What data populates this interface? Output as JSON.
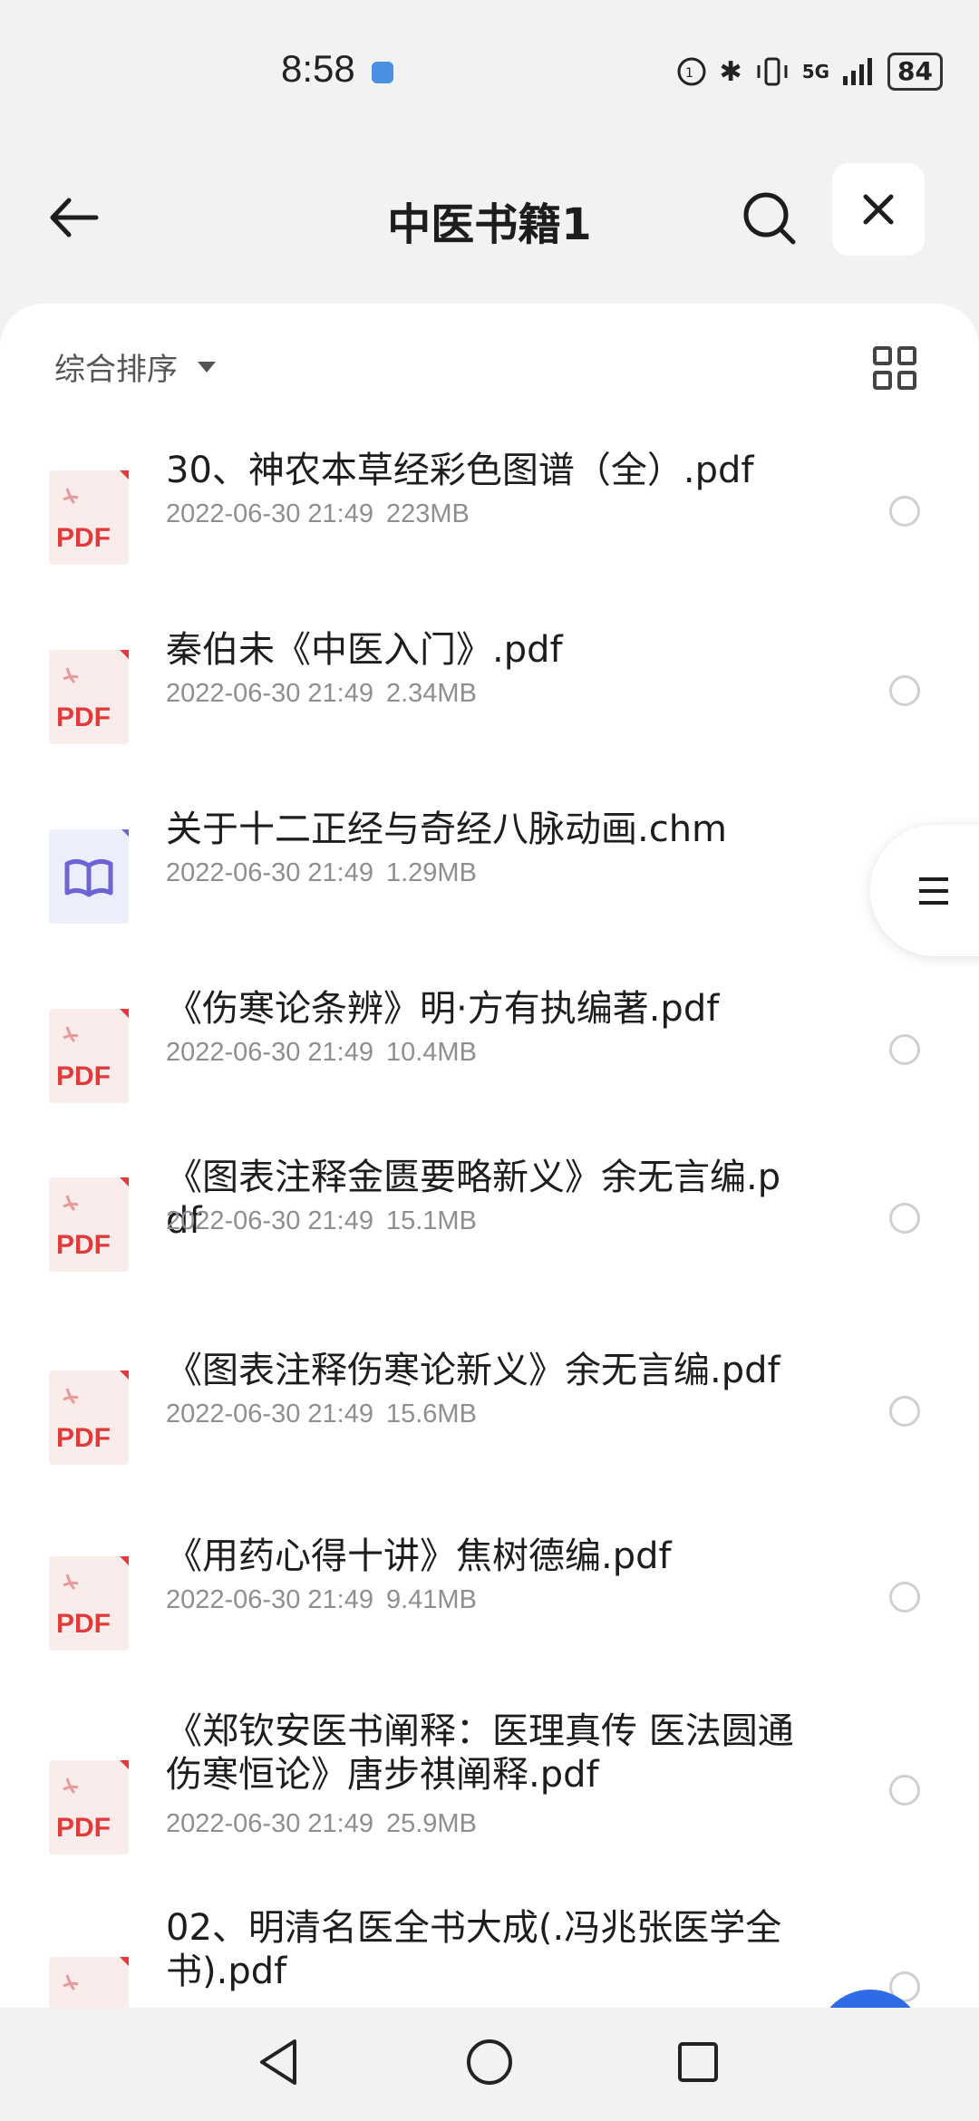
{
  "status": {
    "time": "8:58",
    "battery": "84",
    "network": "5G"
  },
  "header": {
    "title": "中医书籍1"
  },
  "sort": {
    "label": "综合排序"
  },
  "files": [
    {
      "name": "30、神农本草经彩色图谱（全）.pdf",
      "date": "2022-06-30 21:49",
      "size": "223MB",
      "type": "pdf"
    },
    {
      "name": "秦伯未《中医入门》.pdf",
      "date": "2022-06-30 21:49",
      "size": "2.34MB",
      "type": "pdf"
    },
    {
      "name": "关于十二正经与奇经八脉动画.chm",
      "date": "2022-06-30 21:49",
      "size": "1.29MB",
      "type": "chm"
    },
    {
      "name": "《伤寒论条辨》明·方有执编著.pdf",
      "date": "2022-06-30 21:49",
      "size": "10.4MB",
      "type": "pdf"
    },
    {
      "name": "《图表注释金匮要略新义》余无言编.pdf",
      "date": "2022-06-30 21:49",
      "size": "15.1MB",
      "type": "pdf"
    },
    {
      "name": "《图表注释伤寒论新义》余无言编.pdf",
      "date": "2022-06-30 21:49",
      "size": "15.6MB",
      "type": "pdf"
    },
    {
      "name": "《用药心得十讲》焦树德编.pdf",
      "date": "2022-06-30 21:49",
      "size": "9.41MB",
      "type": "pdf"
    },
    {
      "name": "《郑钦安医书阐释：医理真传 医法圆通 伤寒恒论》唐步祺阐释.pdf",
      "date": "2022-06-30 21:49",
      "size": "25.9MB",
      "type": "pdf"
    },
    {
      "name": "02、明清名医全书大成(.冯兆张医学全书).pdf",
      "date": "",
      "size": "",
      "type": "pdf"
    }
  ],
  "icon_labels": {
    "pdf": "PDF"
  },
  "colors": {
    "accent": "#2e6be6",
    "pdf_red": "#e03a3a",
    "chm_purple": "#6b63d6"
  }
}
